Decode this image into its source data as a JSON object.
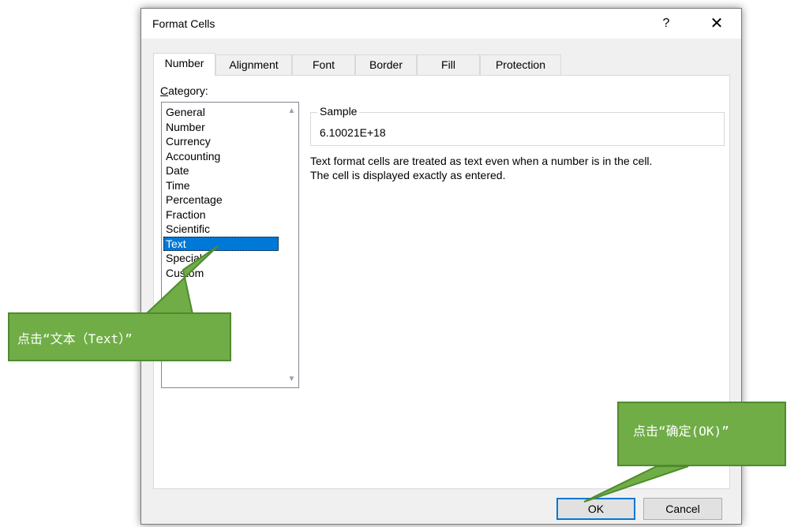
{
  "dialog": {
    "title": "Format Cells",
    "help_label": "?",
    "close_label": "✕"
  },
  "tabs": [
    {
      "label": "Number",
      "active": true
    },
    {
      "label": "Alignment"
    },
    {
      "label": "Font"
    },
    {
      "label": "Border"
    },
    {
      "label": "Fill"
    },
    {
      "label": "Protection"
    }
  ],
  "category": {
    "label_prefix": "C",
    "label_rest": "ategory:",
    "items": [
      "General",
      "Number",
      "Currency",
      "Accounting",
      "Date",
      "Time",
      "Percentage",
      "Fraction",
      "Scientific",
      "Text",
      "Special",
      "Custom"
    ],
    "selected": "Text"
  },
  "sample": {
    "legend": "Sample",
    "value": "6.10021E+18"
  },
  "description": {
    "line1": "Text format cells are treated as text even when a number is in the cell.",
    "line2": "The cell is displayed exactly as entered."
  },
  "buttons": {
    "ok": "OK",
    "cancel": "Cancel"
  },
  "annotations": {
    "callout_text": "点击“文本（Text）”",
    "callout_ok": "点击“确定(OK)”"
  },
  "colors": {
    "accent": "#0078d7",
    "callout_fill": "#70ad47"
  }
}
